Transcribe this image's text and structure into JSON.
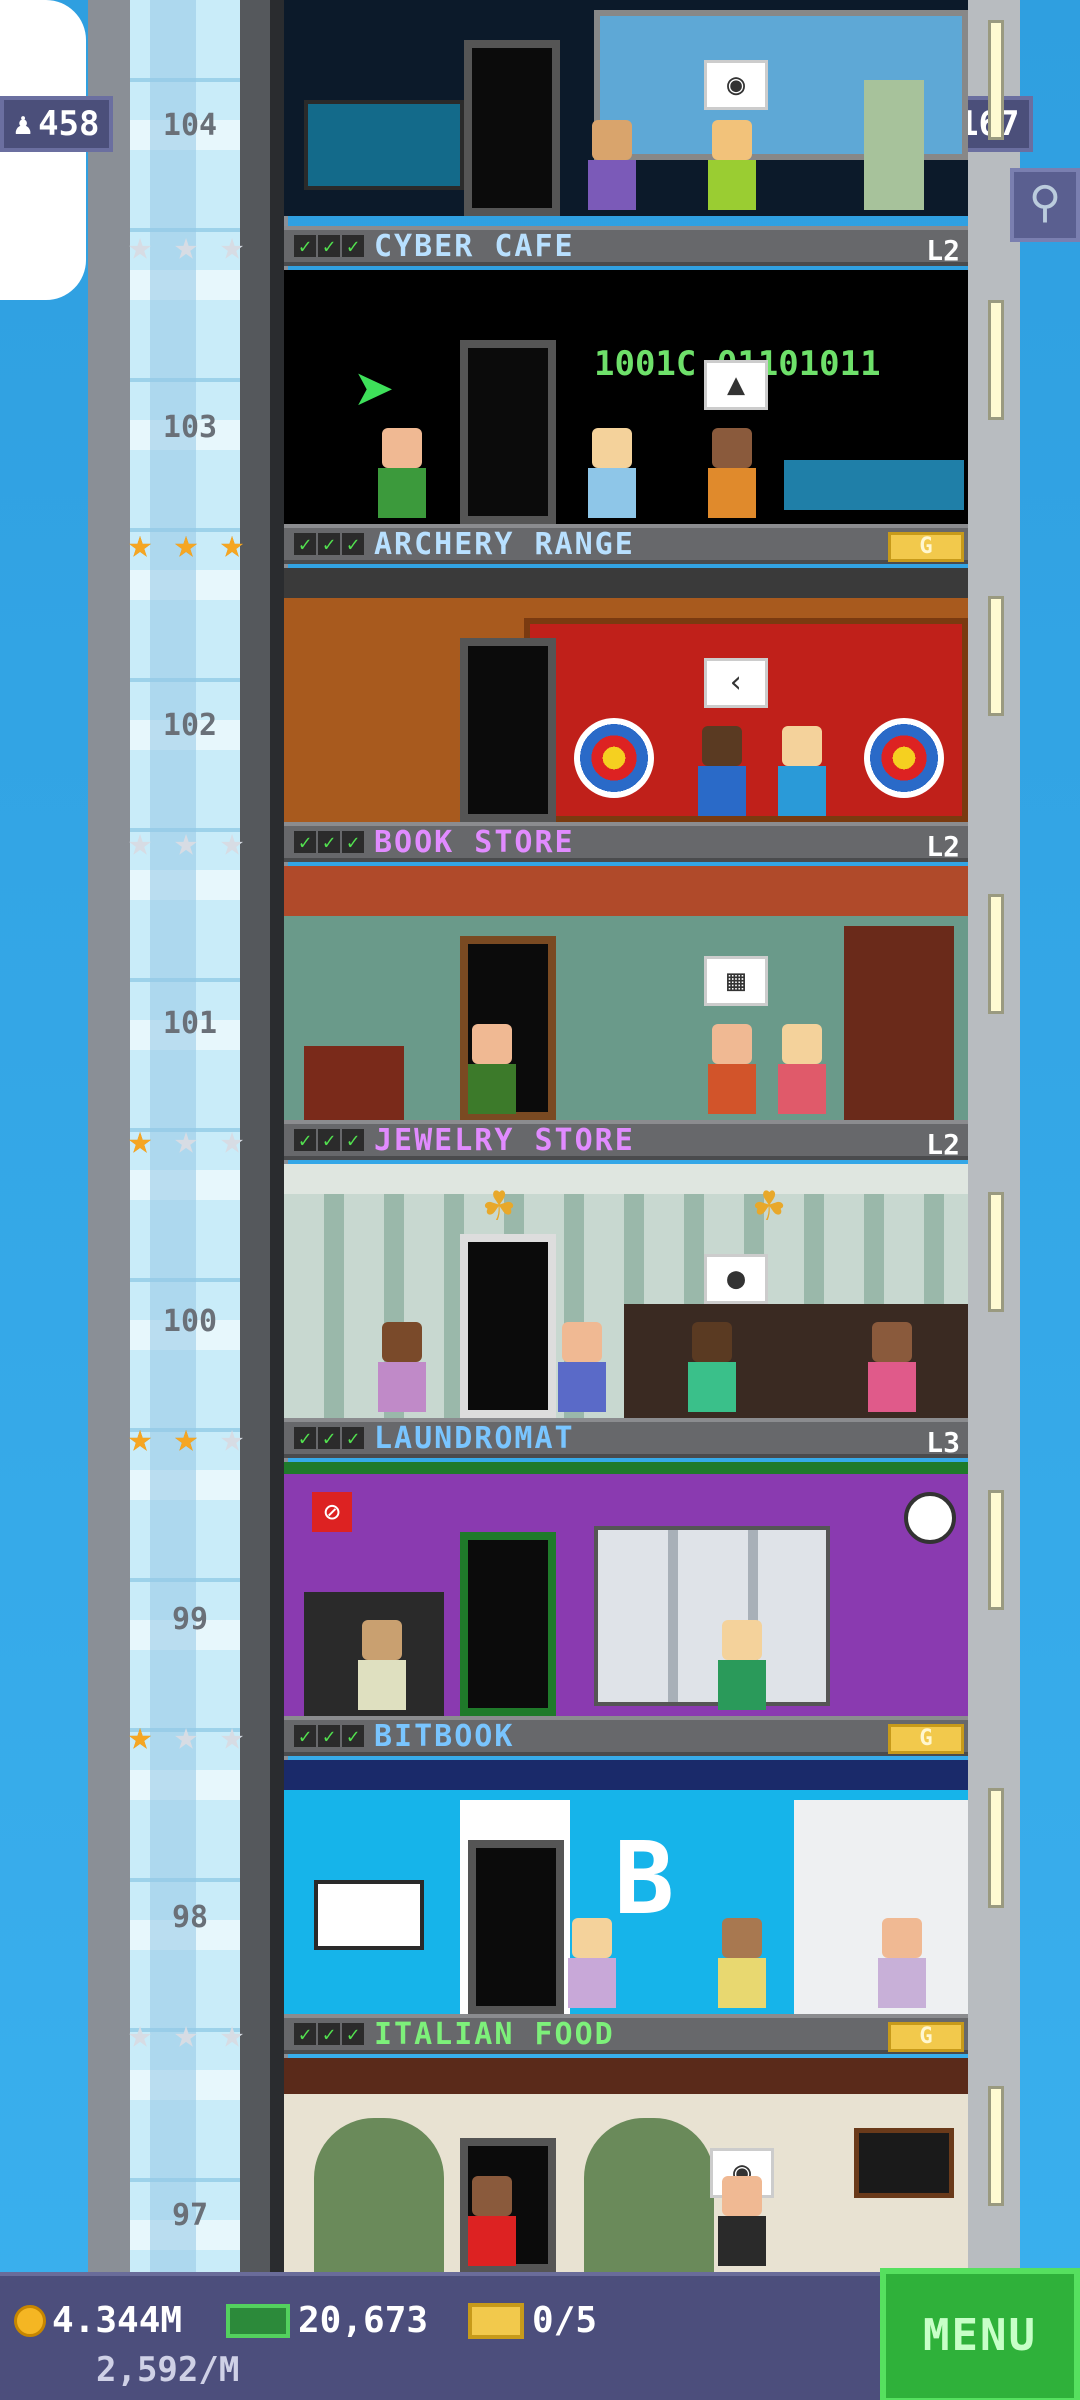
{
  "counters": {
    "population": "458",
    "floors": "167"
  },
  "floors": [
    {
      "number": "104",
      "name": "CYBER CAFE",
      "badge": "L2",
      "badge_type": "level",
      "stars": [
        0,
        0,
        0
      ],
      "name_color": "#b8e0ff"
    },
    {
      "number": "103",
      "name": "ARCHERY RANGE",
      "badge": "G",
      "badge_type": "gold",
      "stars": [
        1,
        1,
        1
      ],
      "name_color": "#b8e0ff",
      "binary_text": "1001C  01101011"
    },
    {
      "number": "102",
      "name": "BOOK STORE",
      "badge": "L2",
      "badge_type": "level",
      "stars": [
        0,
        0,
        0
      ],
      "name_color": "#e18bff"
    },
    {
      "number": "101",
      "name": "JEWELRY STORE",
      "badge": "L2",
      "badge_type": "level",
      "stars": [
        1,
        0,
        0
      ],
      "name_color": "#e18bff"
    },
    {
      "number": "100",
      "name": "LAUNDROMAT",
      "badge": "L3",
      "badge_type": "level",
      "stars": [
        1,
        1,
        0
      ],
      "name_color": "#79c5ff"
    },
    {
      "number": "99",
      "name": "BITBOOK",
      "badge": "G",
      "badge_type": "gold",
      "stars": [
        1,
        0,
        0
      ],
      "name_color": "#79c5ff"
    },
    {
      "number": "98",
      "name": "ITALIAN FOOD",
      "badge": "G",
      "badge_type": "gold",
      "stars": [
        0,
        0,
        0
      ],
      "name_color": "#7df07a"
    },
    {
      "number": "97"
    }
  ],
  "bottom": {
    "coins": "4.344M",
    "bux": "20,673",
    "tickets": "0/5",
    "rate": "2,592/M",
    "menu_label": "MENU"
  },
  "icons": {
    "population": "person-icon",
    "floors": "building-icon",
    "search": "magnifier-icon",
    "coin": "coin-icon",
    "bux": "banknote-icon",
    "ticket": "ticket-icon"
  }
}
